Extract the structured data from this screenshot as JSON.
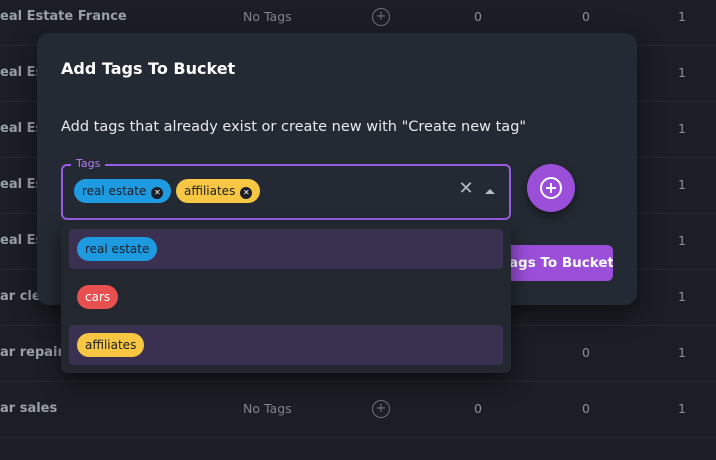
{
  "background_table": {
    "rows": [
      {
        "name": "eal Estate France",
        "tags": "No Tags",
        "c1": "0",
        "c2": "0",
        "c3": "1"
      },
      {
        "name": "eal Es",
        "tags": "",
        "c1": "",
        "c2": "",
        "c3": "1"
      },
      {
        "name": "eal Es",
        "tags": "",
        "c1": "",
        "c2": "",
        "c3": "1"
      },
      {
        "name": "eal Es",
        "tags": "",
        "c1": "",
        "c2": "",
        "c3": "1"
      },
      {
        "name": "eal Es",
        "tags": "",
        "c1": "",
        "c2": "",
        "c3": "1"
      },
      {
        "name": "ar clea",
        "tags": "",
        "c1": "",
        "c2": "",
        "c3": "1"
      },
      {
        "name": "ar repair",
        "tags": "",
        "c1": "",
        "c2": "0",
        "c3": "1"
      },
      {
        "name": "ar sales",
        "tags": "No Tags",
        "c1": "0",
        "c2": "0",
        "c3": "1"
      }
    ]
  },
  "modal": {
    "title": "Add Tags To Bucket",
    "description": "Add tags that already exist or create new with \"Create new tag\"",
    "field_label": "Tags",
    "selected_tags": [
      {
        "label": "real estate",
        "color": "#1e9ae0"
      },
      {
        "label": "affiliates",
        "color": "#f7c744"
      }
    ],
    "submit_label": "Add Tags To Bucket"
  },
  "dropdown": {
    "options": [
      {
        "label": "real estate",
        "color": "#1e9ae0",
        "selected": true
      },
      {
        "label": "cars",
        "color": "#e84f4f",
        "selected": false
      },
      {
        "label": "affiliates",
        "color": "#f7c744",
        "selected": true
      }
    ]
  },
  "colors": {
    "accent": "#9b4fd9",
    "focus_border": "#9b5de5"
  }
}
